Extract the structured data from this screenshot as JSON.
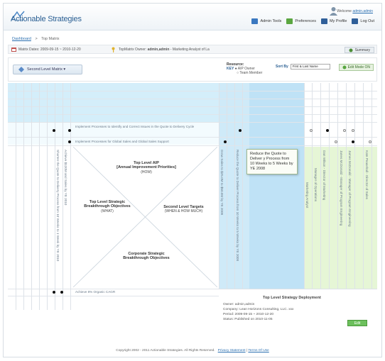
{
  "header": {
    "app_title": "Actionable Strategies",
    "welcome_prefix": "Welcome ",
    "welcome_user": "admin.admin",
    "links": [
      {
        "label": "Admin Tools",
        "color": "#3a78c0"
      },
      {
        "label": "Preferences",
        "color": "#5aa640"
      },
      {
        "label": "My Profile",
        "color": "#2f5f99"
      },
      {
        "label": "Log Out",
        "color": "#2f5f99"
      }
    ]
  },
  "breadcrumb": {
    "home": "Dashboard",
    "sep": ">",
    "current": "Top Matrix"
  },
  "infobar": {
    "dates": "Matrix Dates: 2009-09-15 ~ 2010-12-20",
    "owner_prefix": "TopMatrix Owner: ",
    "owner_name": "admin,admin",
    "owner_suffix": " - Marketing Analyst of La",
    "summary_label": "Summary"
  },
  "toolbar": {
    "slm_label": "Second Level Matrix ▾",
    "resource_title": "Resource:",
    "key_label": "KEY",
    "aip_owner": "● AIP Owner",
    "team_member": "○ Team Member",
    "sortby_label": "Sort By",
    "sort_value": "First & Last Name",
    "edit_label": "Edit Mode ON"
  },
  "matrix": {
    "row_texts": [
      "Implement Processes to Identify and Correct Issues in the Quote to Delivery Cycle",
      "Implement Processes for Global Sales and Global Sales Support"
    ],
    "bottom_row_text": "Achieve 8% Organic CAGR",
    "left_vertical_1": "Shorten the Quote to Delivery Process from 10 Weeks to 1 Week by YE 2010",
    "left_vertical_2": "Achieve $120M and Sales by YE 2010",
    "right_vertical_1": "Grow Sales to $25.0M to $50.0M by YE 2008",
    "right_vertical_2": "Reduce the Quote to Deliver Process from 10 Weeks to 5 Weeks by YE 2008",
    "resource_names": [
      "Marketing Analyst",
      "Manager of Operations",
      "Dan Wilson - Director of Marketing",
      "Janes McDonald - Manager of Program Engineering",
      "James McDonald - Manager of Program Engineering",
      "Kate Peasehall - Director of Sales"
    ],
    "top_title": "Top Level AIP",
    "top_sub": "[Annual Improvement Priorities]",
    "top_how": "(HOW)",
    "left_title": "Top Level Strategic",
    "left_title2": "Breakthrough Objectives",
    "left_what": "(WHAT)",
    "right_title": "Second Level Targets",
    "right_sub": "(WHEN & HOW MUCH)",
    "bottom_title": "Corporate Strategic",
    "bottom_title2": "Breakthrough Objectives",
    "tooltip": "Reduce the Quote to Deliver y Process from 10 Weeks to 5 Weeks by YE 2008"
  },
  "deploy": {
    "title": "Top Level Strategy Deployment",
    "owner": "Owner: admin,admin",
    "company": "Company: Lean Horizons Consulting, LLC. xxx",
    "period": "Period: 2009-09-15 ~ 2010-12-20",
    "status": "Status: Published on 2010-11-05",
    "edit_label": "Edit"
  },
  "footer": {
    "copyright": "Copyright 2002 - 2011 Actionable Strategies.   All Rights Reserved.",
    "privacy": "Privacy Statement",
    "sep": " | ",
    "terms": "Terms Of Use"
  },
  "colors": {
    "blue_zone": "#d4eefa",
    "blue_zone_dark": "#bfe5f6",
    "green_zone": "#e6f6d6",
    "row_tint": "#eef9fd"
  }
}
